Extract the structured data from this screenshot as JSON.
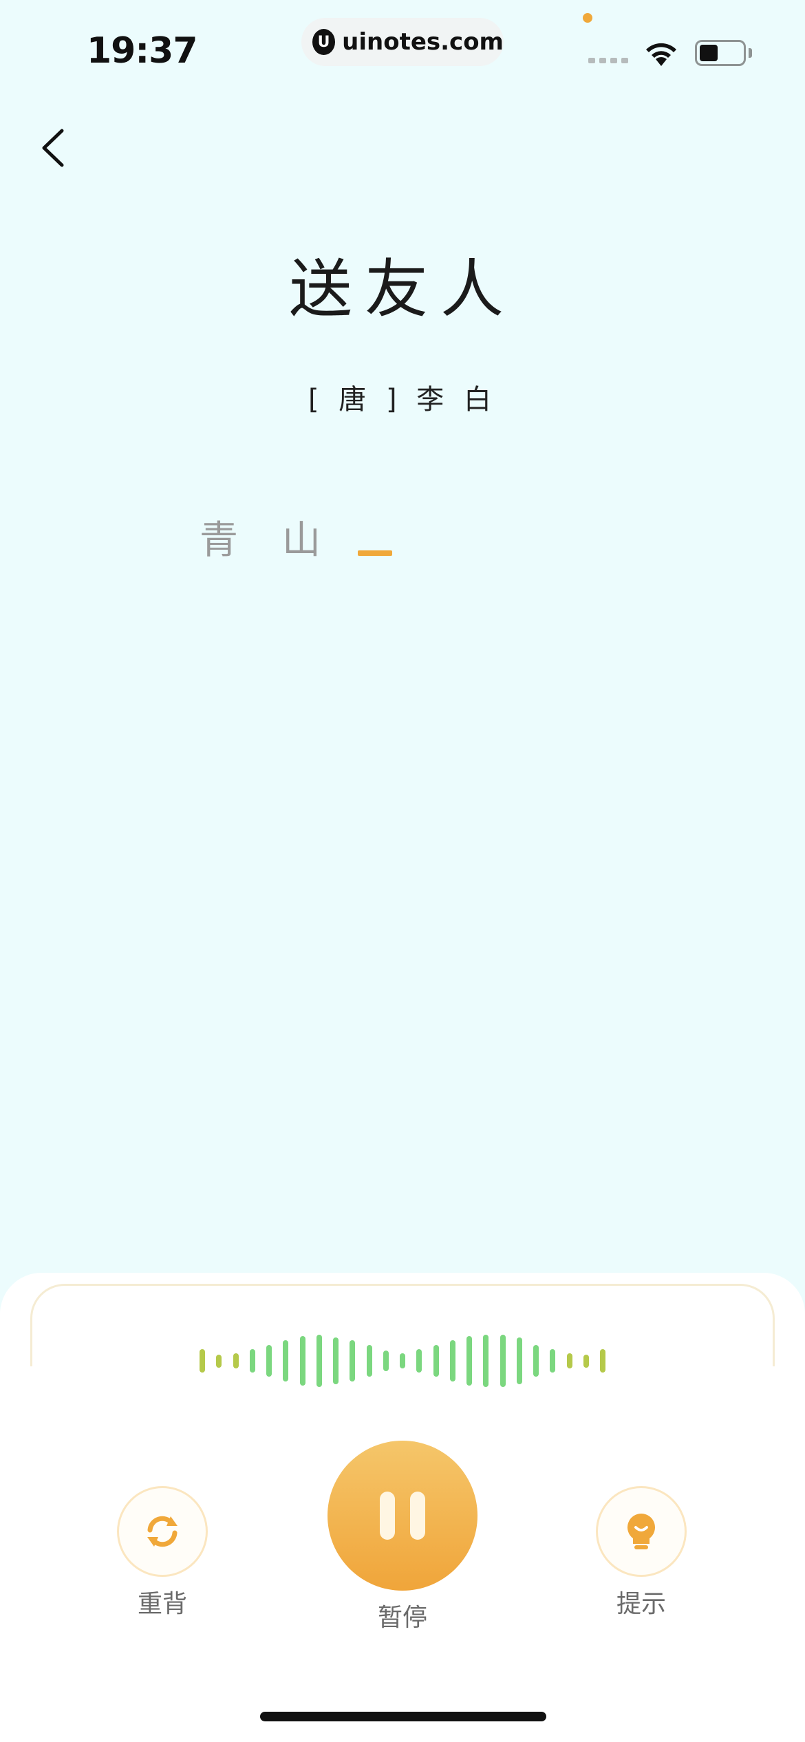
{
  "status_bar": {
    "time": "19:37",
    "url": "uinotes.com",
    "url_logo": "U"
  },
  "navigation": {
    "back_icon": "chevron-left-icon"
  },
  "poem": {
    "title": "送友人",
    "author": "[ 唐 ] 李 白",
    "recited_chars": [
      "青",
      "山"
    ]
  },
  "waveform": {
    "bars": [
      0.45,
      0.25,
      0.3,
      0.45,
      0.6,
      0.8,
      0.95,
      1.0,
      0.9,
      0.8,
      0.6,
      0.4,
      0.3,
      0.45,
      0.6,
      0.8,
      0.95,
      1.0,
      1.0,
      0.9,
      0.6,
      0.45,
      0.3,
      0.25,
      0.45
    ]
  },
  "controls": {
    "restart_label": "重背",
    "pause_label": "暂停",
    "hint_label": "提示"
  },
  "colors": {
    "accent": "#f0a83a",
    "background": "#ecfcfd",
    "wave_edge": "#b5c94a",
    "wave_center": "#7bd77f"
  }
}
